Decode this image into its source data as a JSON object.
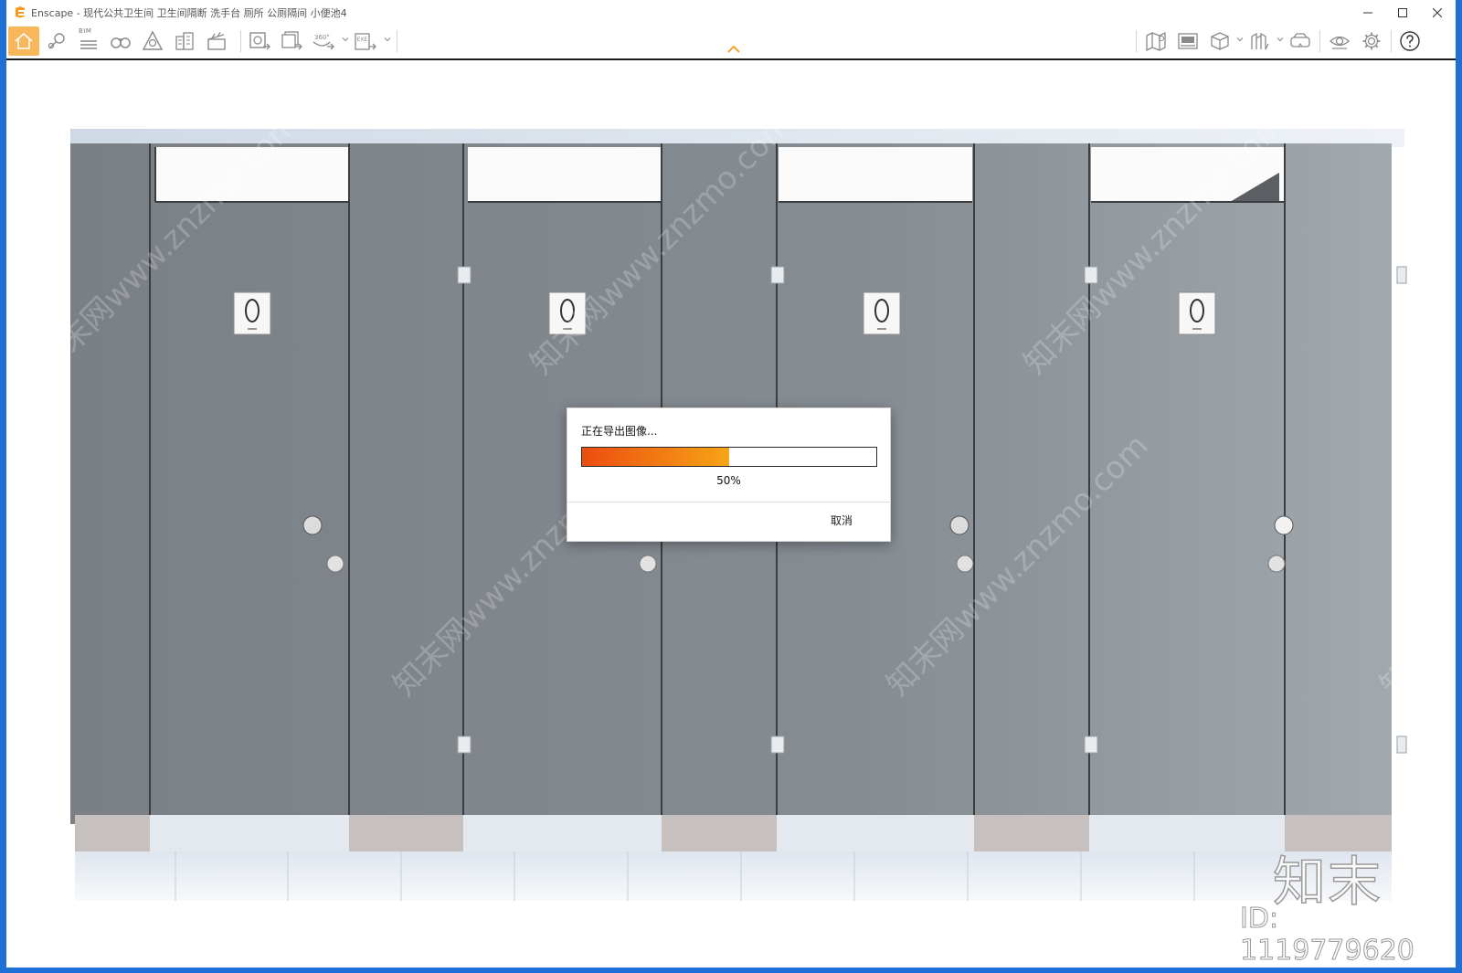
{
  "app": {
    "name": "Enscape",
    "window_title": "Enscape - 现代公共卫生间 卫生间隔断 洗手台 厕所 公厕隔间 小便池4",
    "brand_color": "#f59a1b"
  },
  "titlebar": {
    "controls": [
      "minimize-icon",
      "maximize-icon",
      "close-icon"
    ]
  },
  "toolbar": {
    "left_tools": [
      "home-icon",
      "reference-icon",
      "bim-icon",
      "binoculars-icon",
      "light-icon",
      "building-icon",
      "clapperboard-icon"
    ],
    "bim_label": "BIM",
    "export_tools": [
      "screenshot-export-icon",
      "batch-export-icon",
      "panorama-360-icon",
      "exe-export-icon"
    ],
    "panorama_label": "360°",
    "exe_label": "EXE",
    "right_tools": [
      "map-icon",
      "video-editor-icon",
      "cube-icon",
      "asset-library-icon",
      "vr-headset-icon",
      "view-settings-icon",
      "settings-icon",
      "help-icon"
    ],
    "collapse_icon": "chevron-up-icon"
  },
  "watermark": {
    "text": "知末网www.znzmo.com",
    "brand": "知末",
    "id_text": "ID: 1119779620"
  },
  "scene": {
    "door_sign_icon": "urinal-sign-icon",
    "partition_color": "#7e858b",
    "floor_color": "#f3f5f7"
  },
  "dialog": {
    "title": "正在导出图像...",
    "progress": 0.5,
    "progress_text": "50%",
    "cancel_label": "取消",
    "gradient_start": "#ec4d0f",
    "gradient_end": "#f7a416"
  }
}
